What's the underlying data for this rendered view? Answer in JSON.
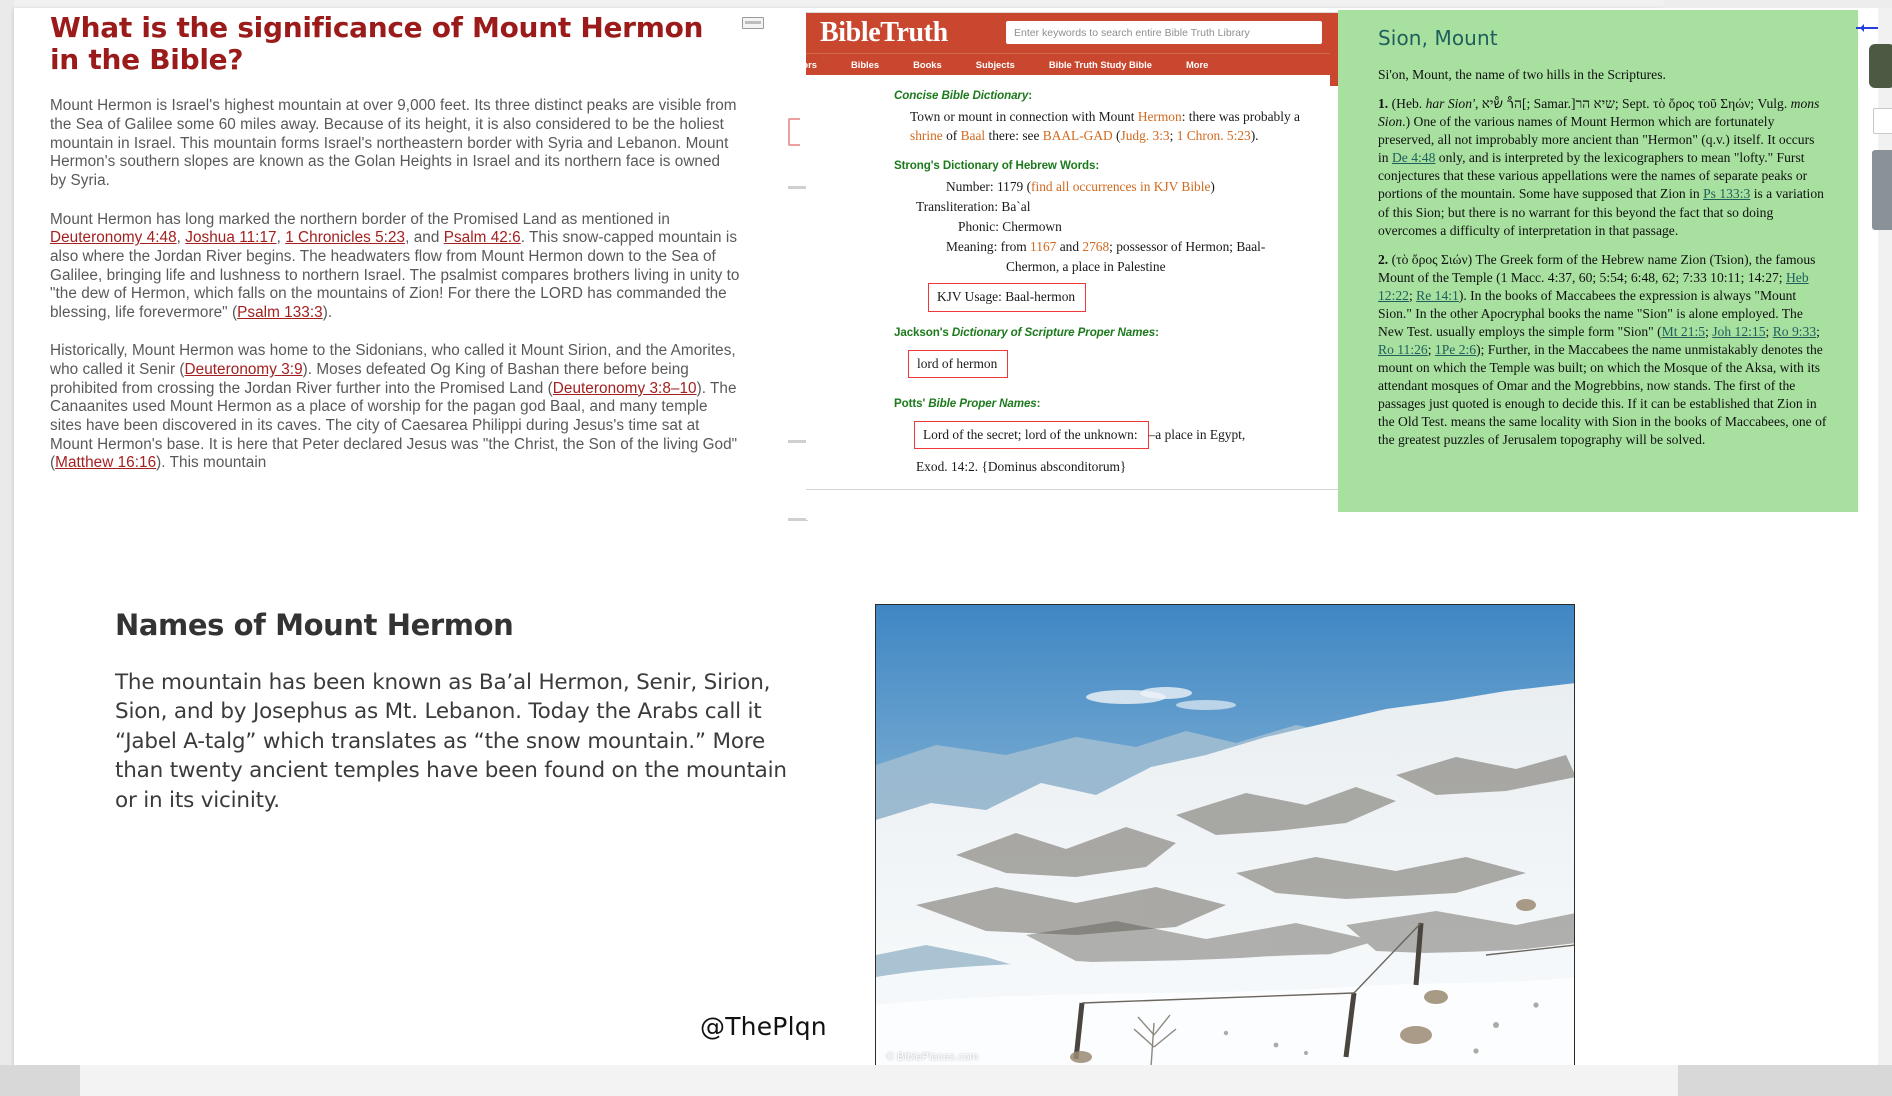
{
  "article": {
    "title": "What is the significance of Mount Hermon in the Bible?",
    "paragraphs": [
      {
        "runs": [
          {
            "t": "Mount Hermon is Israel's highest mountain at over 9,000 feet. Its three distinct peaks are visible from the Sea of Galilee some 60 miles away. Because of its height, it is also considered to be the holiest mountain in Israel. This mountain forms Israel's northeastern border with Syria and Lebanon. Mount Hermon's southern slopes are known as the Golan Heights in Israel and its northern face is owned by Syria."
          }
        ]
      },
      {
        "runs": [
          {
            "t": "Mount Hermon has long marked the northern border of the Promised Land as mentioned in "
          },
          {
            "t": "Deuteronomy 4:48",
            "link": true
          },
          {
            "t": ", "
          },
          {
            "t": "Joshua 11:17",
            "link": true
          },
          {
            "t": ", "
          },
          {
            "t": "1 Chronicles 5:23",
            "link": true
          },
          {
            "t": ", and "
          },
          {
            "t": "Psalm 42:6",
            "link": true
          },
          {
            "t": ". This snow-capped mountain is also where the Jordan River begins. The headwaters flow from Mount Hermon down to the Sea of Galilee, bringing life and lushness to northern Israel. The psalmist compares brothers living in unity to \"the dew of Hermon, which falls on the mountains of Zion! For there the LORD has commanded the blessing, life forevermore\" ("
          },
          {
            "t": "Psalm 133:3",
            "link": true
          },
          {
            "t": ")."
          }
        ]
      },
      {
        "runs": [
          {
            "t": "Historically, Mount Hermon was home to the Sidonians, who called it Mount Sirion, and the Amorites, who called it Senir ("
          },
          {
            "t": "Deuteronomy 3:9",
            "link": true
          },
          {
            "t": "). Moses defeated Og King of Bashan there before being prohibited from crossing the Jordan River further into the Promised Land ("
          },
          {
            "t": "Deuteronomy 3:8–10",
            "link": true
          },
          {
            "t": "). The Canaanites used Mount Hermon as a place of worship for the pagan god Baal, and many temple sites have been discovered in its caves. The city of Caesarea Philippi during Jesus's time sat at Mount Hermon's base. It is here that Peter declared Jesus was \"the Christ, the Son of the living God\" ("
          },
          {
            "t": "Matthew 16:16",
            "link": true
          },
          {
            "t": "). This mountain"
          }
        ]
      }
    ]
  },
  "bibletruth": {
    "brand_bible": "Bible",
    "brand_truth": "Truth",
    "search_placeholder": "Enter keywords to search entire Bible Truth Library",
    "nav": [
      "Authors",
      "Bibles",
      "Books",
      "Subjects",
      "Bible Truth Study Bible",
      "More"
    ],
    "sections": {
      "concise": {
        "heading_italic": "Concise Bible Dictionary",
        "heading_colon": ":",
        "body_runs": [
          {
            "t": "Town or mount in connection with Mount "
          },
          {
            "t": "Hermon",
            "orange": true
          },
          {
            "t": ": there was probably a "
          },
          {
            "t": "shrine",
            "orange": true
          },
          {
            "t": " of "
          },
          {
            "t": "Baal",
            "orange": true
          },
          {
            "t": " there: see "
          },
          {
            "t": "BAAL-GAD",
            "orange": true
          },
          {
            "t": " ("
          },
          {
            "t": "Judg. 3:3",
            "orange": true
          },
          {
            "t": "; "
          },
          {
            "t": "1 Chron. 5:23",
            "orange": true
          },
          {
            "t": ")."
          }
        ]
      },
      "strongs": {
        "heading": "Strong's Dictionary of Hebrew Words:",
        "number_label": "Number: 1179 (",
        "number_link": "find all occurrences in KJV Bible",
        "number_close": ")",
        "transliteration": "Transliteration: Ba`al",
        "phonic": "Phonic: Chermown",
        "meaning_a": "Meaning: from ",
        "meaning_n1": "1167",
        "meaning_b": " and ",
        "meaning_n2": "2768",
        "meaning_c": "; possessor of Hermon; Baal-",
        "meaning_line2": "Chermon, a place in Palestine",
        "kjv_usage": "KJV Usage: Baal-hermon"
      },
      "jackson": {
        "heading_plain": "Jackson's ",
        "heading_italic": "Dictionary of Scripture Proper Names",
        "heading_colon": ":",
        "boxed": "lord of hermon"
      },
      "potts": {
        "heading_plain": "Potts' ",
        "heading_italic": "Bible Proper Names",
        "heading_colon": ":",
        "boxed": "Lord of the secret; lord of the unknown:",
        "after_box": "–a place in Egypt,",
        "line2": "Exod. 14:2. {Dominus absconditorum}"
      }
    }
  },
  "sion": {
    "title": "Sion, Mount",
    "intro": "Si'on, Mount, the name of two hills in the Scriptures.",
    "entry1_runs": [
      {
        "t": "1.",
        "b": true
      },
      {
        "t": " (Heb. "
      },
      {
        "t": "har Sion'",
        "i": true
      },
      {
        "t": ", הרْ שْיא[; Samar.]שיא הר; Sept. τὸ ὄρος τοῦ Σηών; Vulg. "
      },
      {
        "t": "mons Sion",
        "i": true
      },
      {
        "t": ".) One of the various names of Mount Hermon which are fortunately preserved, all not improbably more ancient than \"Hermon\" (q.v.) itself. It occurs in "
      },
      {
        "t": "De 4:48",
        "link": true
      },
      {
        "t": " only, and is interpreted by the lexicographers to mean \"lofty.\" Furst conjectures that these various appellations were the names of separate peaks or portions of the mountain. Some have supposed that Zion in "
      },
      {
        "t": "Ps 133:3",
        "link": true
      },
      {
        "t": " is a variation of this Sion; but there is no warrant for this beyond the fact that so doing overcomes a difficulty of interpretation in that passage."
      }
    ],
    "entry2_runs": [
      {
        "t": "2.",
        "b": true
      },
      {
        "t": " (τὸ ὄρος Σιών) The Greek form of the Hebrew name Zion (Tsion), the famous Mount of the Temple (1 Macc. 4:37, 60; 5:54; 6:48, 62; 7:33 10:11; 14:27; "
      },
      {
        "t": "Heb 12:22",
        "link": true
      },
      {
        "t": "; "
      },
      {
        "t": "Re 14:1",
        "link": true
      },
      {
        "t": "). In the books of Maccabees the expression is always \"Mount Sion.\" In the other Apocryphal books the name \"Sion\" is alone employed. The New Test. usually employs the simple form \"Sion\" ("
      },
      {
        "t": "Mt 21:5",
        "link": true
      },
      {
        "t": "; "
      },
      {
        "t": "Joh 12:15",
        "link": true
      },
      {
        "t": "; "
      },
      {
        "t": "Ro 9:33",
        "link": true
      },
      {
        "t": "; "
      },
      {
        "t": "Ro 11:26",
        "link": true
      },
      {
        "t": "; "
      },
      {
        "t": "1Pe 2:6",
        "link": true
      },
      {
        "t": "); Further, in the Maccabees the name unmistakably denotes the mount on which the Temple was built; on which the Mosque of the Aksa, with its attendant mosques of Omar and the Mogrebbins, now stands. The first of the passages just quoted is enough to decide this. If it can be established that Zion in the Old Test. means the same locality with Sion in the books of Maccabees, one of the greatest puzzles of Jerusalem topography will be solved."
      }
    ]
  },
  "names_section": {
    "heading": "Names of Mount Hermon",
    "body": "The mountain has been known as Ba’al Hermon, Senir, Sirion, Sion, and by Josephus as Mt. Lebanon. Today the Arabs call it “Jabel A-talg” which translates as “the snow mountain.” More than twenty ancient temples have been found on the mountain or in its vicinity."
  },
  "watermark": "@ThePlqn",
  "photo": {
    "credit": "© BiblePlaces.com"
  },
  "colors": {
    "article_heading": "#9b1b1b",
    "article_link": "#a32020",
    "bibletruth_red": "#c8472e",
    "dictionary_green": "#1c7a1c",
    "annotation_red": "#f0373a",
    "sion_bg": "#a8e0a0",
    "sion_title": "#1f5f5b"
  }
}
